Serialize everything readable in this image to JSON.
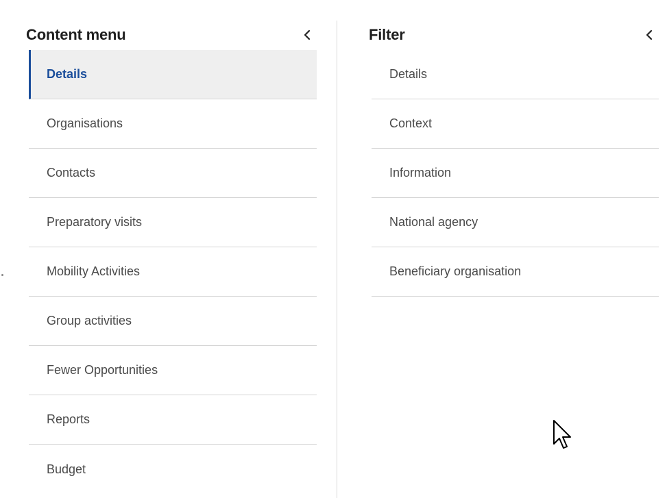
{
  "content_menu": {
    "title": "Content menu",
    "collapse_icon": "chevron-left-icon",
    "items": [
      {
        "label": "Details",
        "active": true
      },
      {
        "label": "Organisations",
        "active": false
      },
      {
        "label": "Contacts",
        "active": false
      },
      {
        "label": "Preparatory visits",
        "active": false
      },
      {
        "label": "Mobility Activities",
        "active": false
      },
      {
        "label": "Group activities",
        "active": false
      },
      {
        "label": "Fewer Opportunities",
        "active": false
      },
      {
        "label": "Reports",
        "active": false
      },
      {
        "label": "Budget",
        "active": false
      }
    ]
  },
  "filter": {
    "title": "Filter",
    "collapse_icon": "chevron-left-icon",
    "items": [
      {
        "label": "Details"
      },
      {
        "label": "Context"
      },
      {
        "label": "Information"
      },
      {
        "label": "National agency"
      },
      {
        "label": "Beneficiary organisation"
      }
    ]
  },
  "colors": {
    "accent": "#1b4e9b",
    "active_bg": "#efefef",
    "divider": "#d4d4d4"
  }
}
